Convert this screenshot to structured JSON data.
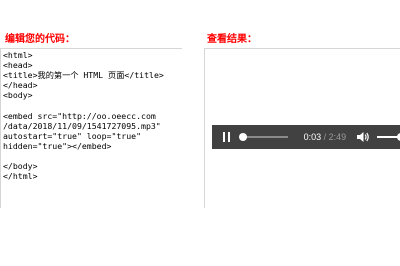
{
  "code_pane": {
    "title": "编辑您的代码：",
    "code": "<html>\n<head>\n<title>我的第一个 HTML 页面</title>\n</head>\n<body>\n\n<embed src=\"http://oo.oeecc.com\n/data/2018/11/09/1541727095.mp3\"\nautostart=\"true\" loop=\"true\"\nhidden=\"true\"></embed>\n\n</body>\n</html>"
  },
  "result_pane": {
    "title": "查看结果："
  },
  "audio_player": {
    "state": "playing",
    "play_icon": "pause-icon",
    "current_time": "0:03",
    "separator": " / ",
    "total_time": "2:49",
    "seek_progress": 0.018,
    "volume_icon": "volume-icon",
    "volume_level": 1.0
  },
  "colors": {
    "title": "#ff0000",
    "player_bg": "#414141",
    "pane_border": "#d6d6d6"
  }
}
